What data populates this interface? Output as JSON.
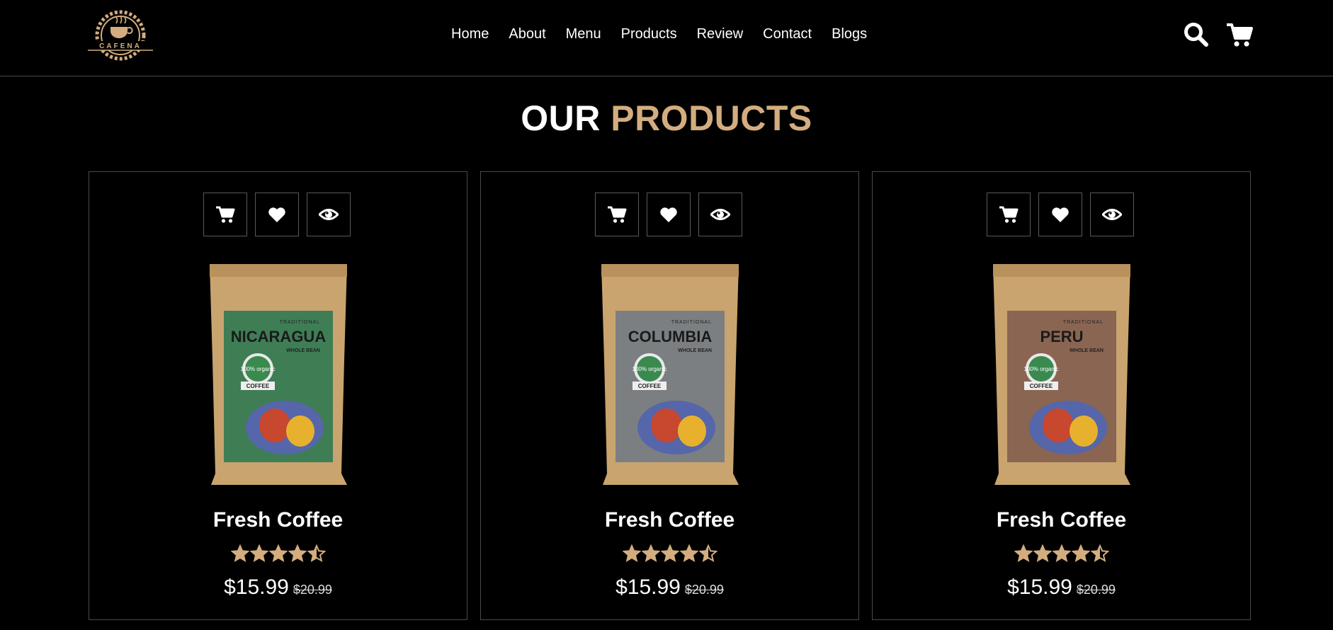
{
  "brand": {
    "logo_text": "CAFENA"
  },
  "nav": {
    "items": [
      "Home",
      "About",
      "Menu",
      "Products",
      "Review",
      "Contact",
      "Blogs"
    ]
  },
  "header_icons": [
    "search-icon",
    "cart-icon"
  ],
  "section": {
    "title_part1": "OUR",
    "title_part2": "PRODUCTS"
  },
  "colors": {
    "accent": "#d3ad7f",
    "background": "#000000",
    "border": "#4a4a4a"
  },
  "product_actions": [
    "cart-icon",
    "heart-icon",
    "eye-icon"
  ],
  "products": [
    {
      "bag_label": "NICARAGUA",
      "bag_sublabel": "WHOLE BEAN",
      "bag_top": "TRADITIONAL",
      "badge": "100% organic",
      "ribbon": "COFFEE",
      "bag_color": "#3f7d55",
      "name": "Fresh Coffee",
      "rating": 4.5,
      "price": "$15.99",
      "old_price": "$20.99"
    },
    {
      "bag_label": "COLUMBIA",
      "bag_sublabel": "WHOLE BEAN",
      "bag_top": "TRADITIONAL",
      "badge": "100% organic",
      "ribbon": "COFFEE",
      "bag_color": "#7b7f82",
      "name": "Fresh Coffee",
      "rating": 4.5,
      "price": "$15.99",
      "old_price": "$20.99"
    },
    {
      "bag_label": "PERU",
      "bag_sublabel": "WHOLE BEAN",
      "bag_top": "TRADITIONAL",
      "badge": "100% organic",
      "ribbon": "COFFEE",
      "bag_color": "#8a6552",
      "name": "Fresh Coffee",
      "rating": 4.5,
      "price": "$15.99",
      "old_price": "$20.99"
    }
  ]
}
